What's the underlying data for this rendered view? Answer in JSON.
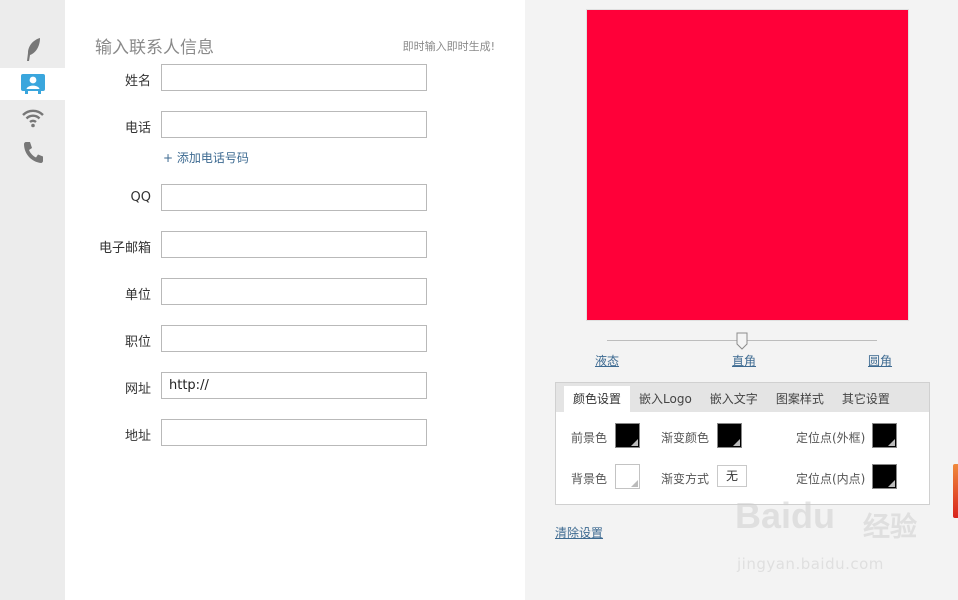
{
  "form": {
    "title": "输入联系人信息",
    "hint": "即时输入即时生成!",
    "fields": [
      {
        "label": "姓名",
        "value": ""
      },
      {
        "label": "电话",
        "value": ""
      },
      {
        "label": "QQ",
        "value": ""
      },
      {
        "label": "电子邮箱",
        "value": ""
      },
      {
        "label": "单位",
        "value": ""
      },
      {
        "label": "职位",
        "value": ""
      },
      {
        "label": "网址",
        "value": "http://"
      },
      {
        "label": "地址",
        "value": ""
      }
    ],
    "add_phone": "+ 添加电话号码"
  },
  "preview": {
    "qr_color": "#ff0039",
    "slider": {
      "labels": [
        "液态",
        "直角",
        "圆角"
      ],
      "selected": "直角"
    }
  },
  "settings": {
    "tabs": [
      "颜色设置",
      "嵌入Logo",
      "嵌入文字",
      "图案样式",
      "其它设置"
    ],
    "active_tab": "颜色设置",
    "items": {
      "foreground": "前景色",
      "gradient_color": "渐变颜色",
      "position_outer": "定位点(外框)",
      "background": "背景色",
      "gradient_mode": "渐变方式",
      "gradient_mode_value": "无",
      "position_inner": "定位点(内点)"
    },
    "colors": {
      "foreground": "#000000",
      "gradient": "#000000",
      "outer": "#000000",
      "background": "#ffffff",
      "inner": "#000000"
    }
  },
  "clear_link": "清除设置",
  "watermark": {
    "brand": "Baidu",
    "cn": "经验",
    "url": "jingyan.baidu.com"
  },
  "icons": [
    "feather-icon",
    "contact-card-icon",
    "wifi-icon",
    "phone-icon"
  ]
}
